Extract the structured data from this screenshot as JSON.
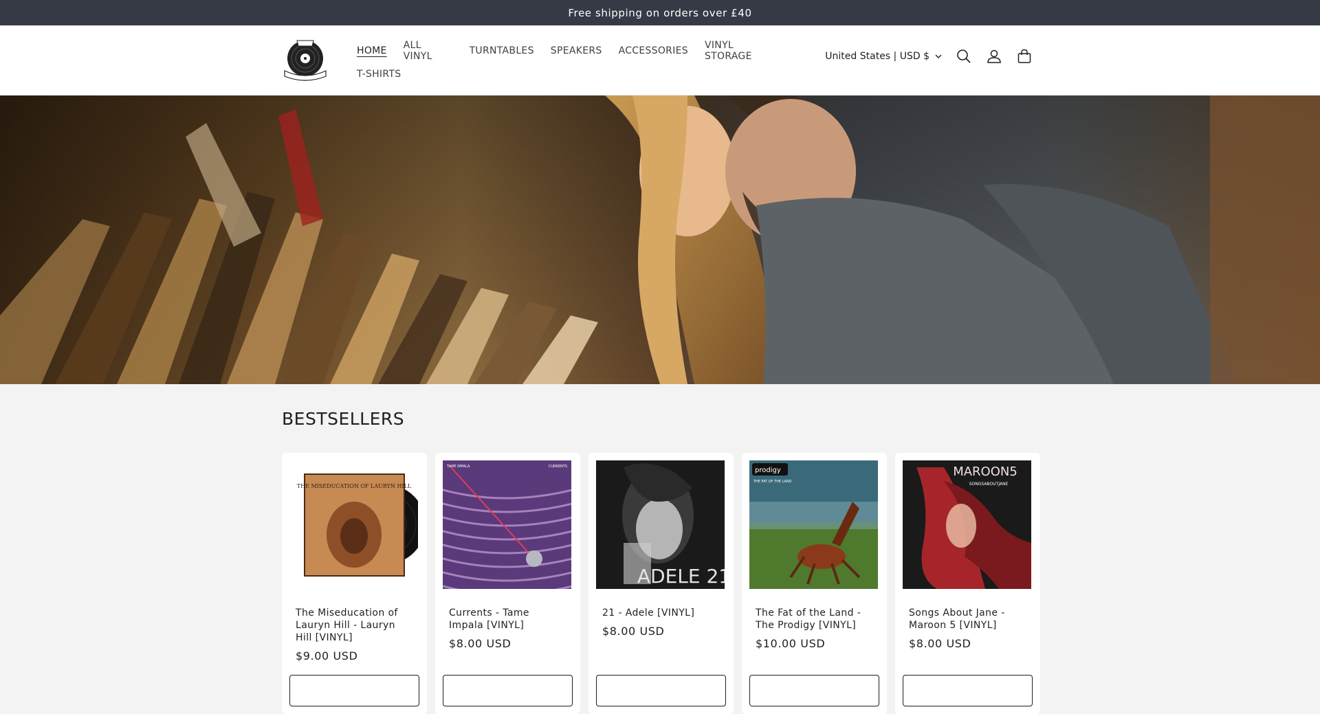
{
  "announcement": {
    "text": "Free shipping on orders over £40"
  },
  "logo": {
    "name": "logo-icon"
  },
  "nav": {
    "items": [
      {
        "label": "HOME",
        "active": true
      },
      {
        "label": "ALL VINYL"
      },
      {
        "label": "TURNTABLES"
      },
      {
        "label": "SPEAKERS"
      },
      {
        "label": "ACCESSORIES"
      },
      {
        "label": "VINYL STORAGE"
      },
      {
        "label": "T-SHIRTS"
      }
    ]
  },
  "header": {
    "country_selector": "United States | USD $",
    "icons": [
      "search-icon",
      "account-icon",
      "cart-icon"
    ]
  },
  "bestsellers": {
    "title": "BESTSELLERS",
    "products": [
      {
        "title": "The Miseducation of Lauryn Hill - Lauryn Hill [VINYL]",
        "price": "$9.00 USD"
      },
      {
        "title": "Currents - Tame Impala [VINYL]",
        "price": "$8.00 USD"
      },
      {
        "title": "21 - Adele [VINYL]",
        "price": "$8.00 USD"
      },
      {
        "title": "The Fat of the Land - The Prodigy [VINYL]",
        "price": "$10.00 USD"
      },
      {
        "title": "Songs About Jane - Maroon 5 [VINYL]",
        "price": "$8.00 USD"
      }
    ]
  },
  "album_art_text": {
    "lauryn": "THE MISEDUCATION OF LAURYN HILL",
    "tame": "TAME IMPALA",
    "tame_right": "CURRENTS",
    "adele": "ADELE 21",
    "prodigy": "prodigy",
    "prodigy_sub": "THE FAT OF THE LAND",
    "maroon": "MAROON5",
    "maroon_sub": "SONGSABOUTJANE"
  },
  "colors": {
    "announcement_bg": "#353a45",
    "page_bg": "#f3f3f3",
    "text": "#1f1f1f"
  }
}
